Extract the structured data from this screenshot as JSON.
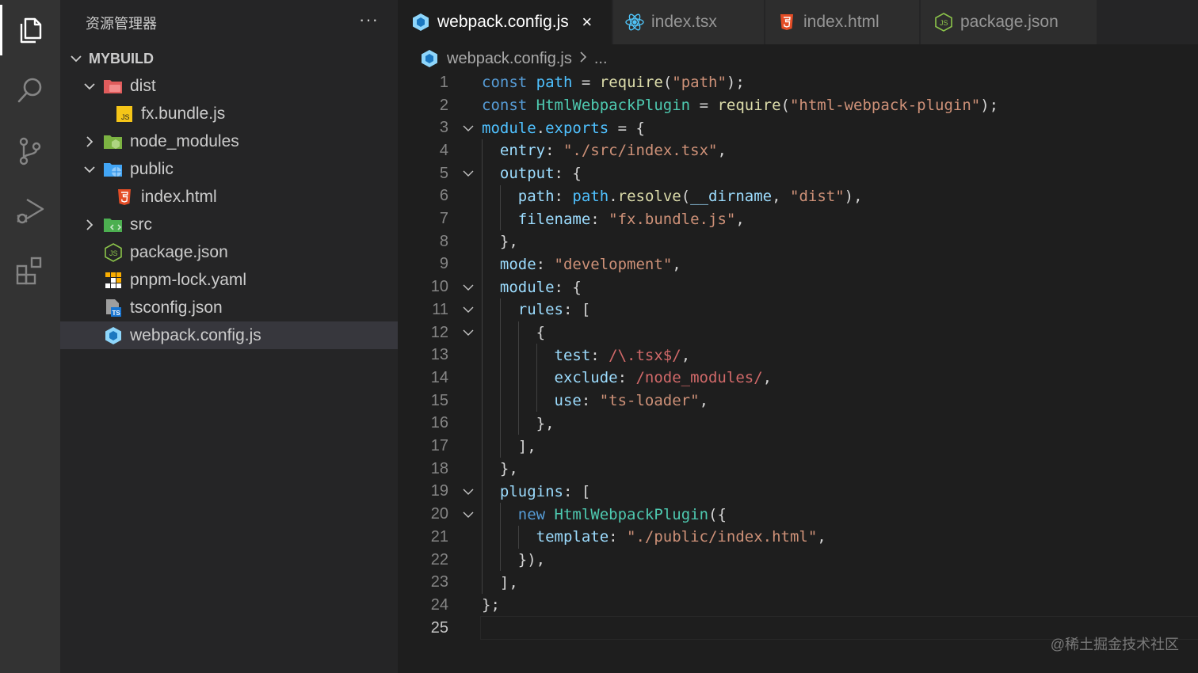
{
  "activity_bar": {
    "items": [
      {
        "name": "explorer-icon",
        "active": true
      },
      {
        "name": "search-icon",
        "active": false
      },
      {
        "name": "source-control-icon",
        "active": false
      },
      {
        "name": "run-debug-icon",
        "active": false
      },
      {
        "name": "extensions-icon",
        "active": false
      }
    ]
  },
  "sidebar": {
    "title": "资源管理器",
    "more": "···",
    "section": "MYBUILD",
    "tree": [
      {
        "label": "dist",
        "kind": "folder",
        "expanded": true,
        "icon": "folder-dist-icon"
      },
      {
        "label": "fx.bundle.js",
        "kind": "file",
        "icon": "js-file-icon"
      },
      {
        "label": "node_modules",
        "kind": "folder",
        "expanded": false,
        "icon": "folder-node-icon"
      },
      {
        "label": "public",
        "kind": "folder",
        "expanded": true,
        "icon": "folder-public-icon"
      },
      {
        "label": "index.html",
        "kind": "file",
        "icon": "html-file-icon"
      },
      {
        "label": "src",
        "kind": "folder",
        "expanded": false,
        "icon": "folder-src-icon"
      },
      {
        "label": "package.json",
        "kind": "file",
        "icon": "nodejs-file-icon"
      },
      {
        "label": "pnpm-lock.yaml",
        "kind": "file",
        "icon": "pnpm-file-icon"
      },
      {
        "label": "tsconfig.json",
        "kind": "file",
        "icon": "tsconfig-file-icon"
      },
      {
        "label": "webpack.config.js",
        "kind": "file",
        "icon": "webpack-file-icon",
        "selected": true
      }
    ]
  },
  "tabs": [
    {
      "label": "webpack.config.js",
      "icon": "webpack-file-icon",
      "active": true,
      "close": "×"
    },
    {
      "label": "index.tsx",
      "icon": "react-file-icon",
      "active": false
    },
    {
      "label": "index.html",
      "icon": "html-file-icon",
      "active": false
    },
    {
      "label": "package.json",
      "icon": "nodejs-file-icon",
      "active": false
    }
  ],
  "breadcrumb": {
    "file": "webpack.config.js",
    "ellipsis": "..."
  },
  "editor": {
    "current_line": 25,
    "lines": [
      {
        "n": "1",
        "text": "const path = require(\"path\");"
      },
      {
        "n": "2",
        "text": "const HtmlWebpackPlugin = require(\"html-webpack-plugin\");"
      },
      {
        "n": "3",
        "text": "module.exports = {"
      },
      {
        "n": "4",
        "text": "  entry: \"./src/index.tsx\","
      },
      {
        "n": "5",
        "text": "  output: {"
      },
      {
        "n": "6",
        "text": "    path: path.resolve(__dirname, \"dist\"),"
      },
      {
        "n": "7",
        "text": "    filename: \"fx.bundle.js\","
      },
      {
        "n": "8",
        "text": "  },"
      },
      {
        "n": "9",
        "text": "  mode: \"development\","
      },
      {
        "n": "10",
        "text": "  module: {"
      },
      {
        "n": "11",
        "text": "    rules: ["
      },
      {
        "n": "12",
        "text": "      {"
      },
      {
        "n": "13",
        "text": "        test: /\\.tsx$/,"
      },
      {
        "n": "14",
        "text": "        exclude: /node_modules/,"
      },
      {
        "n": "15",
        "text": "        use: \"ts-loader\","
      },
      {
        "n": "16",
        "text": "      },"
      },
      {
        "n": "17",
        "text": "    ],"
      },
      {
        "n": "18",
        "text": "  },"
      },
      {
        "n": "19",
        "text": "  plugins: ["
      },
      {
        "n": "20",
        "text": "    new HtmlWebpackPlugin({"
      },
      {
        "n": "21",
        "text": "      template: \"./public/index.html\","
      },
      {
        "n": "22",
        "text": "    }),"
      },
      {
        "n": "23",
        "text": "  ],"
      },
      {
        "n": "24",
        "text": "};"
      },
      {
        "n": "25",
        "text": ""
      }
    ]
  },
  "watermark": "@稀土掘金技术社区",
  "colors": {
    "keyword": "#569cd6",
    "string": "#ce9178",
    "regex": "#d16969",
    "property": "#9cdcfe",
    "function": "#dcdcaa",
    "class": "#4ec9b0",
    "variable": "#4fc1ff"
  }
}
